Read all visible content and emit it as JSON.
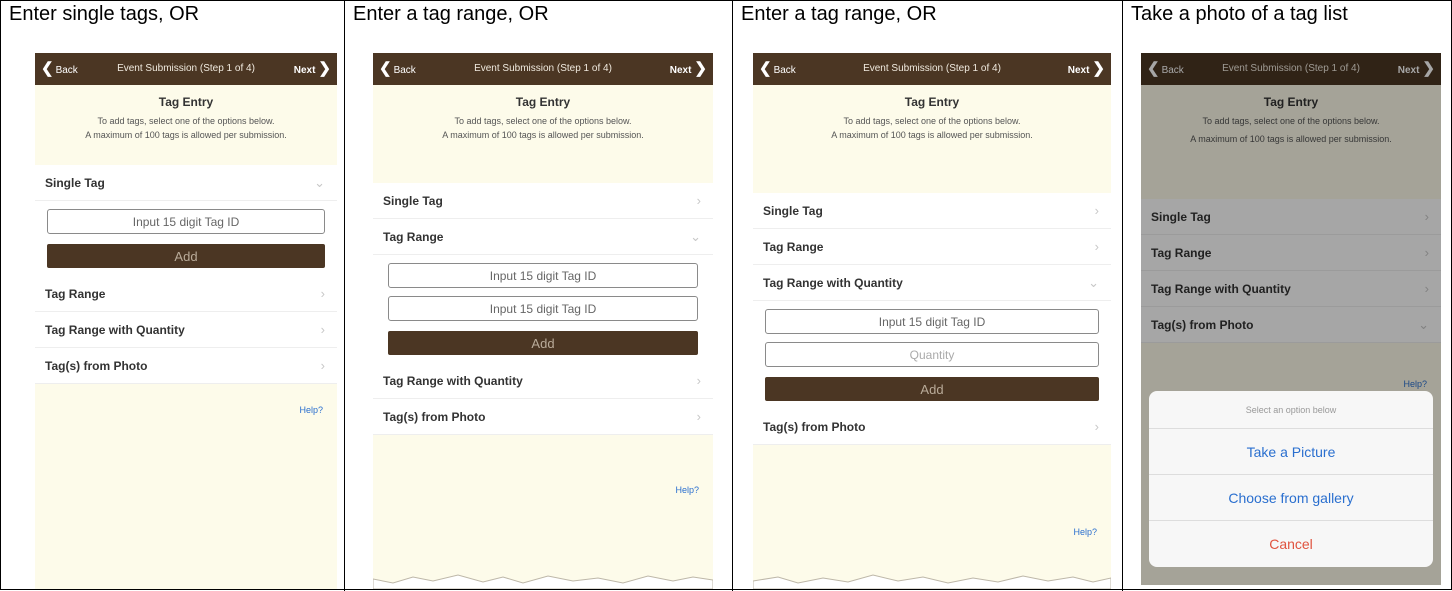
{
  "captions": [
    "Enter single tags, OR",
    "Enter a tag range, OR",
    "Enter a tag range, OR",
    "Take a photo of a tag list"
  ],
  "nav": {
    "back": "Back",
    "title": "Event Submission (Step 1 of 4)",
    "next": "Next"
  },
  "intro": {
    "heading": "Tag Entry",
    "line1": "To add tags, select one of the options below.",
    "line2": "A maximum of 100 tags is allowed per submission."
  },
  "options": {
    "single": "Single Tag",
    "range": "Tag Range",
    "range_qty": "Tag Range with Quantity",
    "photo": "Tag(s) from Photo"
  },
  "inputs": {
    "tag_placeholder": "Input 15 digit Tag ID",
    "quantity_placeholder": "Quantity"
  },
  "add_label": "Add",
  "help": "Help?",
  "action_sheet": {
    "header": "Select an option below",
    "take_picture": "Take a Picture",
    "gallery": "Choose from gallery",
    "cancel": "Cancel"
  },
  "colors": {
    "nav": "#4b3623",
    "panel": "#fdfbea",
    "link": "#2a6fcf",
    "cancel": "#e0533f"
  }
}
